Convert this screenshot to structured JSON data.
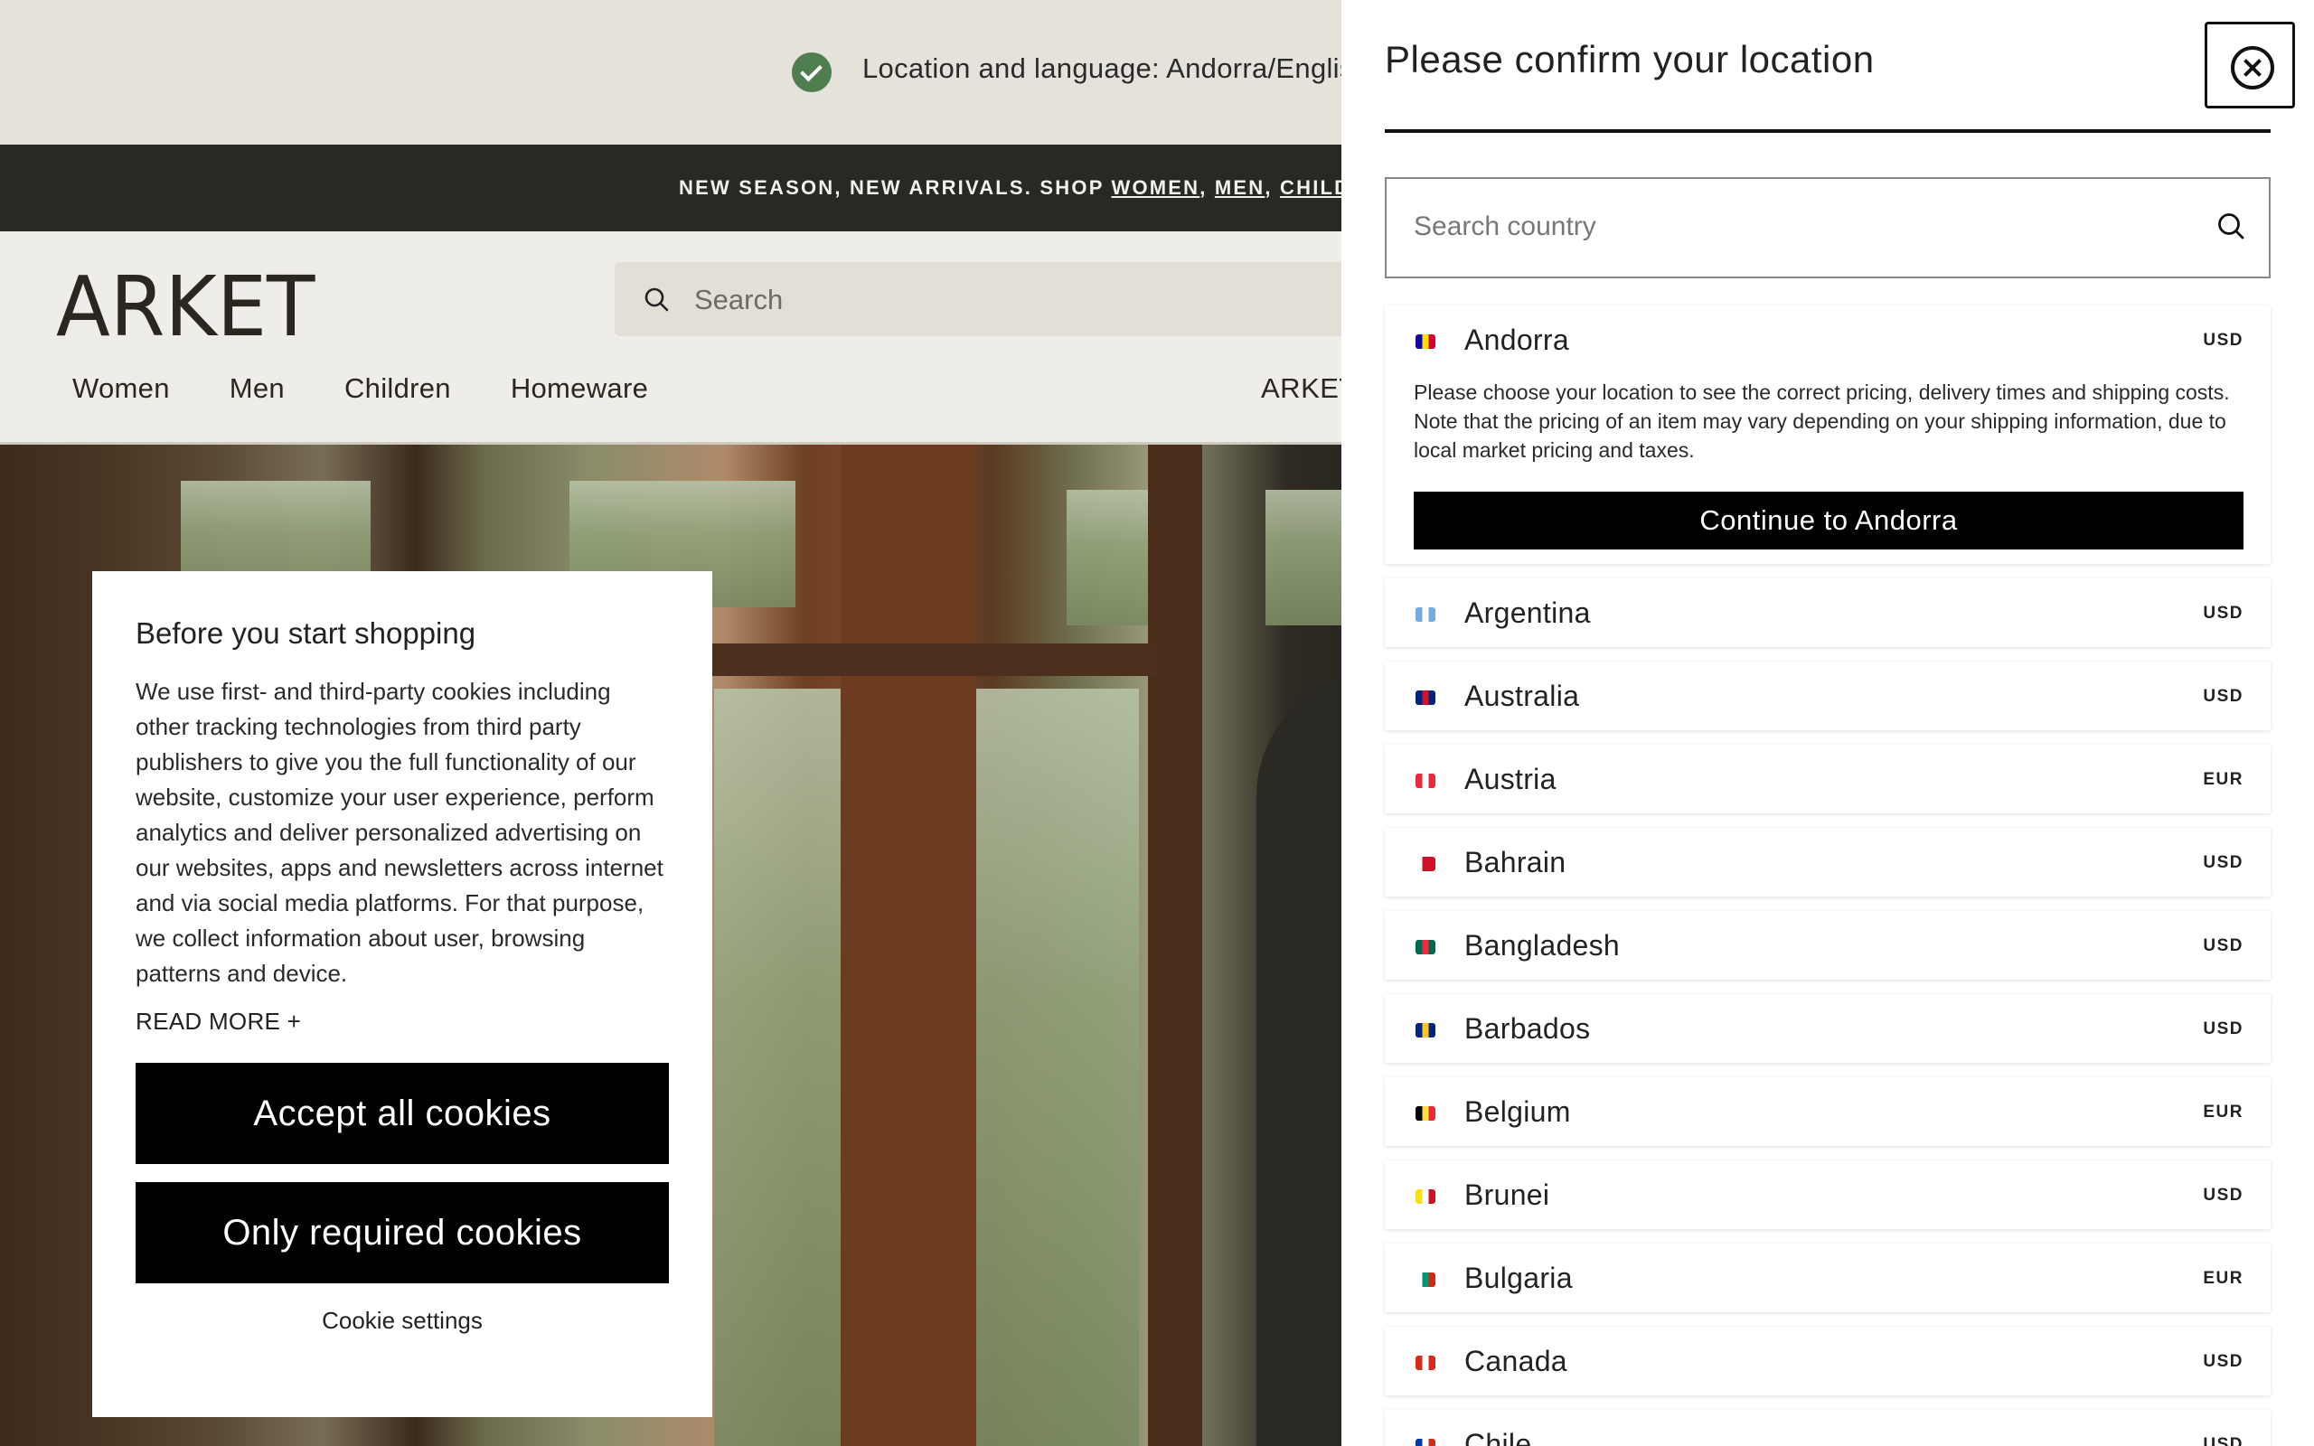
{
  "notice": {
    "text": "Location and language: Andorra/English"
  },
  "announcement": {
    "prefix": "NEW SEASON, NEW ARRIVALS. SHOP ",
    "links": [
      "WOMEN",
      "MEN",
      "CHILDREN"
    ]
  },
  "header": {
    "logo": "ARKET",
    "search_placeholder": "Search",
    "nav": [
      "Women",
      "Men",
      "Children",
      "Homeware"
    ],
    "brand_right": "ARKET"
  },
  "cookie": {
    "title": "Before you start shopping",
    "body": "We use first- and third-party cookies including other tracking technologies from third party publishers to give you the full functionality of our website, customize your user experience, perform analytics and deliver personalized advertising on our websites, apps and newsletters across internet and via social media platforms. For that purpose, we collect information about user, browsing patterns and device.",
    "read_more": "READ MORE +",
    "accept_all": "Accept all cookies",
    "only_required": "Only required cookies",
    "settings": "Cookie settings"
  },
  "panel": {
    "title": "Please confirm your location",
    "search_placeholder": "Search country",
    "selected": {
      "name": "Andorra",
      "currency": "USD",
      "description": "Please choose your location to see the correct pricing, delivery times and shipping costs. Note that the pricing of an item may vary depending on your shipping information, due to local market pricing and taxes.",
      "cta": "Continue to Andorra",
      "flag_colors": [
        "#10069f",
        "#fedf00",
        "#d50032"
      ]
    },
    "countries": [
      {
        "name": "Argentina",
        "currency": "USD",
        "flag_colors": [
          "#74acdf",
          "#ffffff",
          "#74acdf"
        ]
      },
      {
        "name": "Australia",
        "currency": "USD",
        "flag_colors": [
          "#00247d",
          "#cf142b",
          "#00247d"
        ]
      },
      {
        "name": "Austria",
        "currency": "EUR",
        "flag_colors": [
          "#ed2939",
          "#ffffff",
          "#ed2939"
        ]
      },
      {
        "name": "Bahrain",
        "currency": "USD",
        "flag_colors": [
          "#ffffff",
          "#ce1126",
          "#ce1126"
        ]
      },
      {
        "name": "Bangladesh",
        "currency": "USD",
        "flag_colors": [
          "#006a4e",
          "#f42a41",
          "#006a4e"
        ]
      },
      {
        "name": "Barbados",
        "currency": "USD",
        "flag_colors": [
          "#00267f",
          "#ffc726",
          "#00267f"
        ]
      },
      {
        "name": "Belgium",
        "currency": "EUR",
        "flag_colors": [
          "#000000",
          "#fae042",
          "#ed2939"
        ]
      },
      {
        "name": "Brunei",
        "currency": "USD",
        "flag_colors": [
          "#f7e017",
          "#ffffff",
          "#cf1126"
        ]
      },
      {
        "name": "Bulgaria",
        "currency": "EUR",
        "flag_colors": [
          "#ffffff",
          "#00966e",
          "#d62612"
        ]
      },
      {
        "name": "Canada",
        "currency": "USD",
        "flag_colors": [
          "#d52b1e",
          "#ffffff",
          "#d52b1e"
        ]
      },
      {
        "name": "Chile",
        "currency": "USD",
        "flag_colors": [
          "#0039a6",
          "#ffffff",
          "#d52b1e"
        ]
      }
    ]
  }
}
